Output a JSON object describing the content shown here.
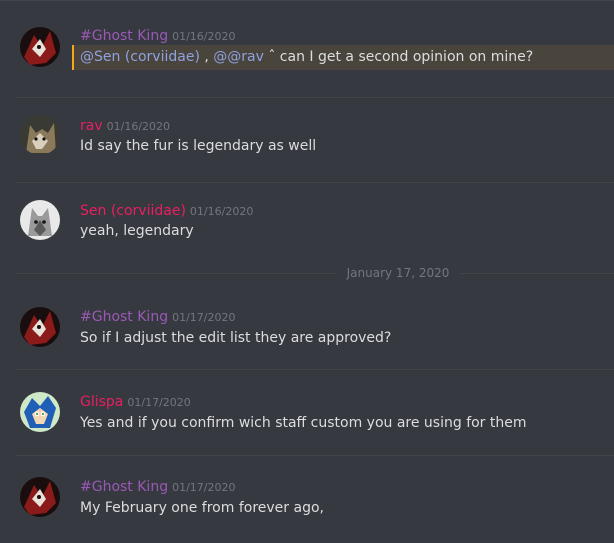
{
  "colors": {
    "background": "#36393f",
    "mention_highlight": "#49443c",
    "mention_bar": "#faa61a",
    "mention_text": "#8ea1e1",
    "ghost_king": "#9b59b6",
    "pink": "#e91e63",
    "timestamp": "#72767d",
    "text": "#dcddde"
  },
  "messages": [
    {
      "author": "#Ghost King",
      "timestamp": "01/16/2020",
      "avatar": "ghost-king-avatar",
      "mention_1": "@Sen (corviidae)",
      "separator": " , ",
      "mention_2": "@@rav",
      "text": " ˆ can I get a second opinion on mine?"
    },
    {
      "author": "rav",
      "timestamp": "01/16/2020",
      "avatar": "rav-avatar",
      "text": "Id say the fur is legendary as well"
    },
    {
      "author": "Sen (corviidae)",
      "timestamp": "01/16/2020",
      "avatar": "sen-avatar",
      "text": "yeah, legendary"
    },
    {
      "author": "#Ghost King",
      "timestamp": "01/17/2020",
      "avatar": "ghost-king-avatar",
      "text": "So if I adjust the edit list they are approved?"
    },
    {
      "author": "Glispa",
      "timestamp": "01/17/2020",
      "avatar": "glispa-avatar",
      "text": "Yes and if you confirm wich staff custom you are using for them"
    },
    {
      "author": "#Ghost King",
      "timestamp": "01/17/2020",
      "avatar": "ghost-king-avatar",
      "text": "My February one from forever ago,"
    }
  ],
  "date_separator": "January 17, 2020"
}
